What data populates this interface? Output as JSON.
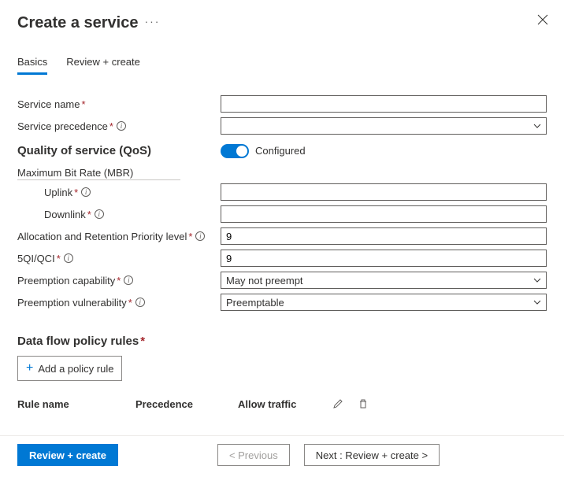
{
  "header": {
    "title": "Create a service"
  },
  "tabs": {
    "basics": "Basics",
    "review": "Review + create"
  },
  "labels": {
    "service_name": "Service name",
    "service_precedence": "Service precedence",
    "qos_title": "Quality of service (QoS)",
    "mbr_title": "Maximum Bit Rate (MBR)",
    "uplink": "Uplink",
    "downlink": "Downlink",
    "arp": "Allocation and Retention Priority level",
    "fiveqi": "5QI/QCI",
    "preempt_cap": "Preemption capability",
    "preempt_vuln": "Preemption vulnerability",
    "rules_title": "Data flow policy rules",
    "add_rule": "Add a policy rule",
    "col_rule": "Rule name",
    "col_prec": "Precedence",
    "col_allow": "Allow traffic",
    "configured": "Configured"
  },
  "values": {
    "service_name": "",
    "service_precedence": "",
    "uplink": "",
    "downlink": "",
    "arp": "9",
    "fiveqi": "9",
    "preempt_cap": "May not preempt",
    "preempt_vuln": "Preemptable"
  },
  "footer": {
    "review": "Review + create",
    "prev": "< Previous",
    "next": "Next : Review + create >"
  }
}
